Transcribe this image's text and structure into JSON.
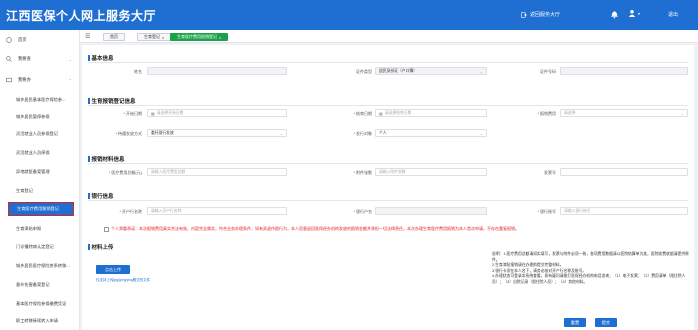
{
  "header": {
    "title": "江西医保个人网上服务大厅",
    "back_label": "返回服务大厅",
    "user_name": " ",
    "logout_label": "退出"
  },
  "sidebar": {
    "items": [
      {
        "label": "首页"
      },
      {
        "label": "我要查"
      },
      {
        "label": "我要办"
      }
    ],
    "sub_items": [
      {
        "label": "城乡居民基本医疗保险参..."
      },
      {
        "label": "城乡居民暂停参保"
      },
      {
        "label": "灵活就业人员参保登记"
      },
      {
        "label": "灵活就业人员停保"
      },
      {
        "label": "异地就医备案管理"
      },
      {
        "label": "生育登记"
      },
      {
        "label": "生育医疗费用报销登记"
      },
      {
        "label": "生育津贴申报"
      },
      {
        "label": "门诊慢特病认定登记"
      },
      {
        "label": "城乡居民医疗保险关系转移..."
      },
      {
        "label": "意外伤害备案登记"
      },
      {
        "label": "基本医疗保险参保缴费凭证"
      },
      {
        "label": "职工转移接续转入申请"
      }
    ]
  },
  "tabs": [
    {
      "label": "首页"
    },
    {
      "label": "生育登记"
    },
    {
      "label": "生育医疗费用报销登记"
    }
  ],
  "sections": {
    "basic": {
      "title": "基本信息",
      "name_label": "姓名",
      "id_type_label": "证件类型",
      "id_type_value": "居民身份证（户口簿）",
      "id_no_label": "证件号码"
    },
    "birth": {
      "title": "生育报销登记信息",
      "start_date_label": "开始日期",
      "start_date_placeholder": "请选择开始日期",
      "end_date_label": "结束日期",
      "end_date_placeholder": "请选择结束日期",
      "reimburse_type_label": "报销费用",
      "reimburse_type_placeholder": "请选择",
      "fund_method_label": "待遇发放方式",
      "fund_method_value": "委托银行发放",
      "object_label": "发行对象",
      "object_value": "个人"
    },
    "material": {
      "title": "报销材料信息",
      "hospital_label": "医疗费用总额(元)",
      "hospital_placeholder": "请输入医疗费用总额",
      "invoice_label": "附件张数",
      "invoice_placeholder": "请输入附件张数",
      "ratio_label": "发票号",
      "ratio_placeholder": ""
    },
    "bank": {
      "title": "银行信息",
      "account_name_label": "开户行名称",
      "account_name_placeholder": "请输入开户行名称",
      "bank_label": "银行户名",
      "bank_placeholder": "",
      "account_no_label": "银行账号",
      "account_no_placeholder": "请输入银行账号"
    },
    "notice": "个人郑重承诺：本次报销费用真实合法有效，内容完全属实，符合业务办理条件，如有弄虚作假行为，本人愿意退回医保经办机构发放的报销金额并承担一切法律责任。本次办理生育医疗费用报销为本人首次申请，不存在重复报销。",
    "upload": {
      "title": "材料上传",
      "button_label": "点击上传",
      "hint": "仅支持上传jpg/jpeg/png格式的文件"
    },
    "notes": [
      "说明：1.医疗费用总额请如实填写，发票与附件必须一致，各项费用数据请以医院结算单为准，医院收费收据请提供原件。",
      "2.生育津贴报销请在办理前提交完整材料。",
      "3.银行卡须在本人名下，请务必核对开户行名称及账号。",
      "4.办理状态可登录本系统查看，如有疑问请拨打医保经办机构电话咨询；（1）电子发票；（2）费用清单（限住院人员）；（3）出院记录（限住院人员）；（4）其他材料。"
    ],
    "buttons": {
      "reset": "重置",
      "submit": "提交"
    }
  },
  "colors": {
    "primary": "#1e6fd1",
    "active_tab": "#1ba14a",
    "required": "#e02020"
  }
}
